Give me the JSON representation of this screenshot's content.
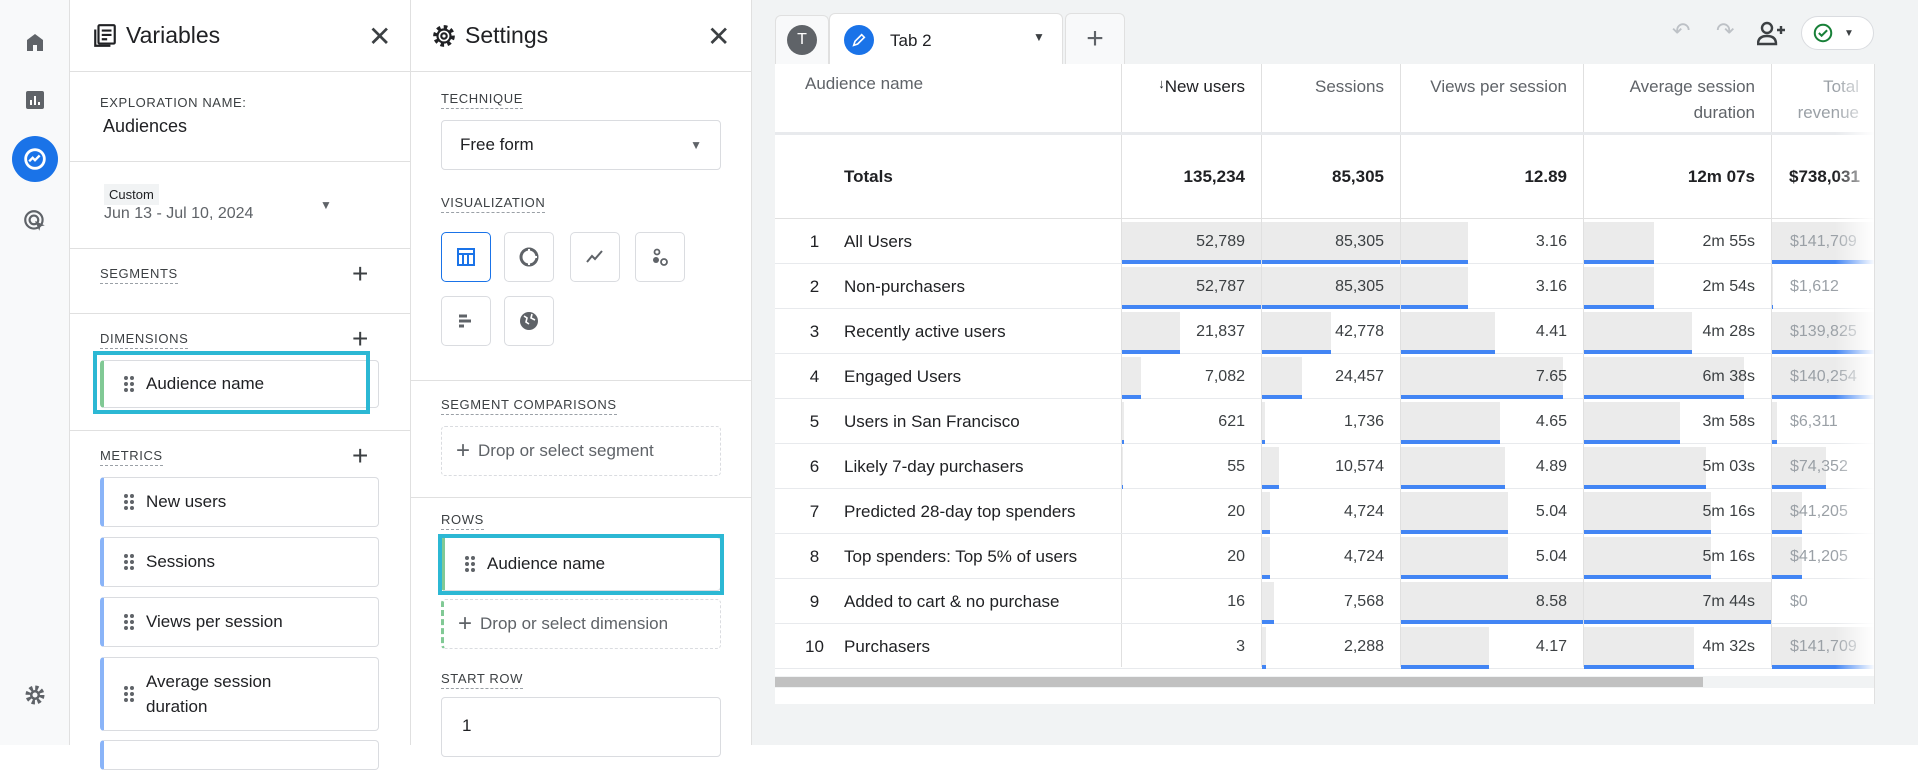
{
  "rail": {
    "items": [
      "home-icon",
      "reports-icon",
      "explore-icon",
      "advertising-icon"
    ],
    "settings": "gear-icon",
    "accent": "#1a73e8"
  },
  "variables": {
    "title": "Variables",
    "exploration_label": "EXPLORATION NAME:",
    "exploration_name": "Audiences",
    "date_badge": "Custom",
    "date_range": "Jun 13 - Jul 10, 2024",
    "segments_label": "SEGMENTS",
    "dimensions_label": "DIMENSIONS",
    "dimensions": [
      "Audience name"
    ],
    "metrics_label": "METRICS",
    "metrics": [
      "New users",
      "Sessions",
      "Views per session",
      "Average session duration"
    ]
  },
  "settings": {
    "title": "Settings",
    "technique_label": "TECHNIQUE",
    "technique": "Free form",
    "visualization_label": "VISUALIZATION",
    "visualizations": [
      "table-icon",
      "donut-chart-icon",
      "line-chart-icon",
      "scatter-plot-icon",
      "bar-chart-icon",
      "geo-map-icon"
    ],
    "segment_comparisons_label": "SEGMENT COMPARISONS",
    "drop_segment": "Drop or select segment",
    "rows_label": "ROWS",
    "rows": [
      "Audience name"
    ],
    "drop_dimension": "Drop or select dimension",
    "start_row_label": "START ROW",
    "start_row": "1"
  },
  "tabs": {
    "avatar": "T",
    "active": "Tab 2"
  },
  "table": {
    "columns": [
      "Audience name",
      "New users",
      "Sessions",
      "Views per session",
      "Average session duration",
      "Total revenue"
    ],
    "sort_icon": "↓",
    "totals_label": "Totals",
    "totals": [
      "135,234",
      "85,305",
      "12.89",
      "12m 07s",
      "$738,031"
    ],
    "rows": [
      {
        "i": "1",
        "name": "All Users",
        "v": [
          "52,789",
          "85,305",
          "3.16",
          "2m 55s",
          "$141,709"
        ],
        "f": [
          1,
          1,
          0.368,
          0.377,
          1
        ]
      },
      {
        "i": "2",
        "name": "Non-purchasers",
        "v": [
          "52,787",
          "85,305",
          "3.16",
          "2m 54s",
          "$1,612"
        ],
        "f": [
          1,
          1,
          0.368,
          0.375,
          0.011
        ]
      },
      {
        "i": "3",
        "name": "Recently active users",
        "v": [
          "21,837",
          "42,778",
          "4.41",
          "4m 28s",
          "$139,825"
        ],
        "f": [
          0.414,
          0.501,
          0.514,
          0.578,
          0.987
        ]
      },
      {
        "i": "4",
        "name": "Engaged Users",
        "v": [
          "7,082",
          "24,457",
          "7.65",
          "6m 38s",
          "$140,254"
        ],
        "f": [
          0.134,
          0.287,
          0.892,
          0.858,
          0.99
        ]
      },
      {
        "i": "5",
        "name": "Users in San Francisco",
        "v": [
          "621",
          "1,736",
          "4.65",
          "3m 58s",
          "$6,311"
        ],
        "f": [
          0.012,
          0.02,
          0.542,
          0.513,
          0.045
        ]
      },
      {
        "i": "6",
        "name": "Likely 7-day purchasers",
        "v": [
          "55",
          "10,574",
          "4.89",
          "5m 03s",
          "$74,352"
        ],
        "f": [
          0.001,
          0.124,
          0.57,
          0.653,
          0.525
        ]
      },
      {
        "i": "7",
        "name": "Predicted 28-day top spenders",
        "v": [
          "20",
          "4,724",
          "5.04",
          "5m 16s",
          "$41,205"
        ],
        "f": [
          0,
          0.055,
          0.587,
          0.681,
          0.291
        ]
      },
      {
        "i": "8",
        "name": "Top spenders: Top 5% of users",
        "v": [
          "20",
          "4,724",
          "5.04",
          "5m 16s",
          "$41,205"
        ],
        "f": [
          0,
          0.055,
          0.587,
          0.681,
          0.291
        ]
      },
      {
        "i": "9",
        "name": "Added to cart & no purchase",
        "v": [
          "16",
          "7,568",
          "8.58",
          "7m 44s",
          "$0"
        ],
        "f": [
          0,
          0.089,
          1,
          1,
          0
        ]
      },
      {
        "i": "10",
        "name": "Purchasers",
        "v": [
          "3",
          "2,288",
          "4.17",
          "4m 32s",
          "$141,709"
        ],
        "f": [
          0,
          0.027,
          0.486,
          0.586,
          1
        ]
      }
    ],
    "bar_color": "#4285f4"
  }
}
